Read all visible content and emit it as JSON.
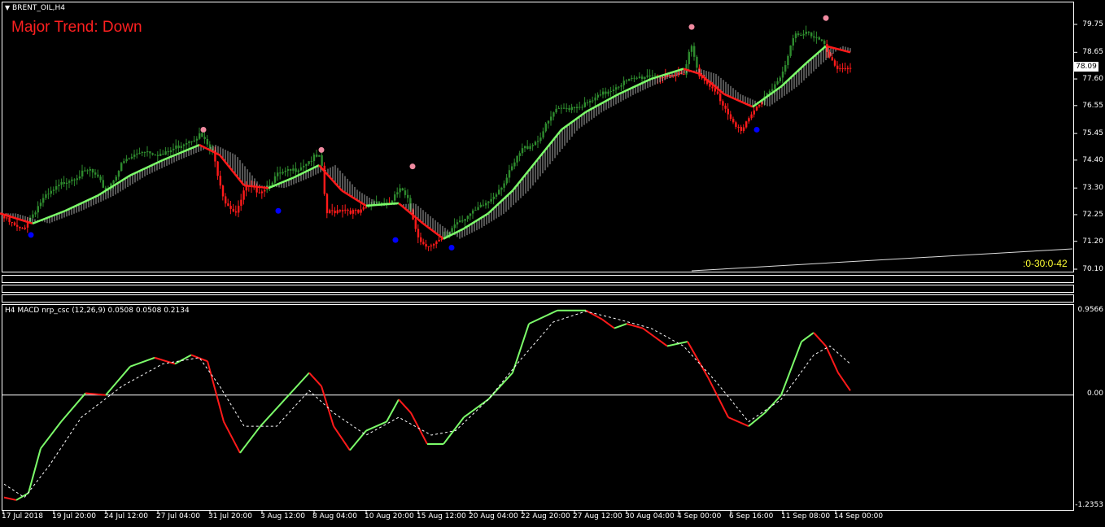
{
  "window": {
    "symbol_title": "BRENT_OIL,H4"
  },
  "main_chart": {
    "trend_text": "Major Trend: Down",
    "timer_text": ":0-30:0-42",
    "current_price": "78.09",
    "price_ticks": [
      "79.75",
      "78.65",
      "77.60",
      "76.55",
      "75.45",
      "74.40",
      "73.30",
      "72.25",
      "71.20",
      "70.10"
    ]
  },
  "indicator_panel": {
    "label": "H4 MACD nrp_csc (12,26,9) 0.0508 0.0508 0.2134",
    "ticks": [
      "0.9566",
      "0.00",
      "-1.2353"
    ]
  },
  "time_axis": {
    "labels": [
      "17 Jul 2018",
      "19 Jul 20:00",
      "24 Jul 12:00",
      "27 Jul 04:00",
      "31 Jul 20:00",
      "3 Aug 12:00",
      "8 Aug 04:00",
      "10 Aug 20:00",
      "15 Aug 12:00",
      "20 Aug 04:00",
      "22 Aug 20:00",
      "27 Aug 12:00",
      "30 Aug 04:00",
      "4 Sep 00:00",
      "6 Sep 16:00",
      "11 Sep 08:00",
      "14 Sep 00:00"
    ]
  },
  "colors": {
    "bull": "#2e8b2e",
    "bear": "#ff1a1a",
    "ma_up": "#7cfc6a",
    "ma_down": "#ff1a1a",
    "trend_text": "#ff2020",
    "timer_text": "#ffff33",
    "pink_dot": "#f08aa0",
    "blue_dot": "#0000ff"
  },
  "chart_data": [
    {
      "type": "candlestick",
      "title": "BRENT_OIL,H4",
      "ylim": [
        70.1,
        79.75
      ],
      "close_path": [
        [
          0,
          72.2
        ],
        [
          25,
          71.6
        ],
        [
          50,
          72.8
        ],
        [
          80,
          73.6
        ],
        [
          110,
          74.0
        ],
        [
          130,
          73.2
        ],
        [
          150,
          74.3
        ],
        [
          175,
          74.8
        ],
        [
          200,
          74.6
        ],
        [
          225,
          75.1
        ],
        [
          245,
          75.4
        ],
        [
          260,
          74.7
        ],
        [
          275,
          72.8
        ],
        [
          290,
          72.3
        ],
        [
          300,
          73.3
        ],
        [
          320,
          73.2
        ],
        [
          340,
          73.8
        ],
        [
          360,
          74.0
        ],
        [
          385,
          74.5
        ],
        [
          393,
          74.5
        ],
        [
          400,
          72.3
        ],
        [
          420,
          72.5
        ],
        [
          440,
          72.3
        ],
        [
          460,
          72.8
        ],
        [
          480,
          72.7
        ],
        [
          490,
          73.3
        ],
        [
          500,
          72.8
        ],
        [
          515,
          71.2
        ],
        [
          530,
          71.0
        ],
        [
          545,
          71.3
        ],
        [
          560,
          72.0
        ],
        [
          580,
          72.3
        ],
        [
          600,
          72.8
        ],
        [
          620,
          73.6
        ],
        [
          640,
          74.8
        ],
        [
          660,
          75.2
        ],
        [
          680,
          76.3
        ],
        [
          700,
          76.5
        ],
        [
          720,
          76.6
        ],
        [
          740,
          77.0
        ],
        [
          760,
          77.4
        ],
        [
          780,
          77.6
        ],
        [
          800,
          77.8
        ],
        [
          820,
          77.6
        ],
        [
          840,
          77.9
        ],
        [
          848,
          79.0
        ],
        [
          860,
          77.6
        ],
        [
          880,
          77.0
        ],
        [
          895,
          76.2
        ],
        [
          910,
          75.5
        ],
        [
          925,
          76.3
        ],
        [
          940,
          77.0
        ],
        [
          960,
          77.7
        ],
        [
          975,
          79.3
        ],
        [
          990,
          79.5
        ],
        [
          1010,
          79.0
        ],
        [
          1025,
          78.0
        ],
        [
          1045,
          78.1
        ]
      ],
      "ma_path": [
        [
          0,
          72.3
        ],
        [
          40,
          71.9
        ],
        [
          80,
          72.4
        ],
        [
          120,
          73.0
        ],
        [
          160,
          73.8
        ],
        [
          200,
          74.4
        ],
        [
          245,
          75.0
        ],
        [
          270,
          74.6
        ],
        [
          300,
          73.4
        ],
        [
          330,
          73.3
        ],
        [
          360,
          73.7
        ],
        [
          392,
          74.2
        ],
        [
          420,
          73.2
        ],
        [
          450,
          72.6
        ],
        [
          490,
          72.7
        ],
        [
          520,
          71.9
        ],
        [
          545,
          71.3
        ],
        [
          570,
          71.7
        ],
        [
          600,
          72.3
        ],
        [
          630,
          73.2
        ],
        [
          660,
          74.4
        ],
        [
          690,
          75.6
        ],
        [
          720,
          76.3
        ],
        [
          760,
          77.0
        ],
        [
          800,
          77.6
        ],
        [
          840,
          78.0
        ],
        [
          860,
          77.8
        ],
        [
          890,
          77.0
        ],
        [
          925,
          76.5
        ],
        [
          960,
          77.3
        ],
        [
          990,
          78.2
        ],
        [
          1015,
          78.9
        ],
        [
          1045,
          78.65
        ]
      ],
      "pink_dots": [
        [
          250,
          75.6
        ],
        [
          395,
          74.8
        ],
        [
          507,
          74.15
        ],
        [
          850,
          79.65
        ],
        [
          1015,
          80.0
        ]
      ],
      "blue_dots": [
        [
          38,
          71.45
        ],
        [
          342,
          72.4
        ],
        [
          486,
          71.25
        ],
        [
          555,
          70.95
        ],
        [
          930,
          75.6
        ]
      ]
    },
    {
      "type": "line",
      "title": "H4 MACD nrp_csc (12,26,9)",
      "ylim": [
        -1.2353,
        0.9566
      ],
      "series": [
        {
          "values_path": [
            [
              5,
              -1.15
            ],
            [
              20,
              -1.18
            ],
            [
              35,
              -1.1
            ],
            [
              50,
              -0.6
            ],
            [
              75,
              -0.3
            ],
            [
              105,
              0.02
            ],
            [
              130,
              0.0
            ],
            [
              160,
              0.32
            ],
            [
              190,
              0.42
            ],
            [
              215,
              0.35
            ],
            [
              235,
              0.45
            ],
            [
              255,
              0.38
            ],
            [
              275,
              -0.3
            ],
            [
              295,
              -0.65
            ],
            [
              320,
              -0.35
            ],
            [
              350,
              -0.05
            ],
            [
              380,
              0.25
            ],
            [
              395,
              0.1
            ],
            [
              410,
              -0.35
            ],
            [
              430,
              -0.62
            ],
            [
              450,
              -0.4
            ],
            [
              475,
              -0.3
            ],
            [
              490,
              -0.05
            ],
            [
              505,
              -0.2
            ],
            [
              525,
              -0.55
            ],
            [
              545,
              -0.55
            ],
            [
              570,
              -0.25
            ],
            [
              600,
              -0.05
            ],
            [
              630,
              0.25
            ],
            [
              650,
              0.8
            ],
            [
              685,
              0.95
            ],
            [
              720,
              0.95
            ],
            [
              740,
              0.85
            ],
            [
              755,
              0.75
            ],
            [
              770,
              0.8
            ],
            [
              790,
              0.75
            ],
            [
              820,
              0.55
            ],
            [
              845,
              0.6
            ],
            [
              870,
              0.2
            ],
            [
              895,
              -0.25
            ],
            [
              920,
              -0.35
            ],
            [
              940,
              -0.2
            ],
            [
              960,
              0.0
            ],
            [
              985,
              0.6
            ],
            [
              1000,
              0.7
            ],
            [
              1015,
              0.55
            ],
            [
              1030,
              0.25
            ],
            [
              1045,
              0.05
            ]
          ]
        },
        {
          "name": "signal",
          "values_path": [
            [
              5,
              -1.0
            ],
            [
              30,
              -1.15
            ],
            [
              60,
              -0.8
            ],
            [
              100,
              -0.25
            ],
            [
              150,
              0.1
            ],
            [
              200,
              0.35
            ],
            [
              245,
              0.42
            ],
            [
              270,
              0.1
            ],
            [
              300,
              -0.35
            ],
            [
              340,
              -0.35
            ],
            [
              380,
              0.05
            ],
            [
              410,
              -0.2
            ],
            [
              450,
              -0.45
            ],
            [
              490,
              -0.25
            ],
            [
              530,
              -0.45
            ],
            [
              560,
              -0.4
            ],
            [
              600,
              -0.05
            ],
            [
              640,
              0.4
            ],
            [
              680,
              0.82
            ],
            [
              720,
              0.94
            ],
            [
              760,
              0.85
            ],
            [
              800,
              0.75
            ],
            [
              840,
              0.55
            ],
            [
              880,
              0.15
            ],
            [
              920,
              -0.3
            ],
            [
              960,
              -0.05
            ],
            [
              1000,
              0.45
            ],
            [
              1020,
              0.55
            ],
            [
              1045,
              0.35
            ]
          ]
        }
      ]
    }
  ]
}
